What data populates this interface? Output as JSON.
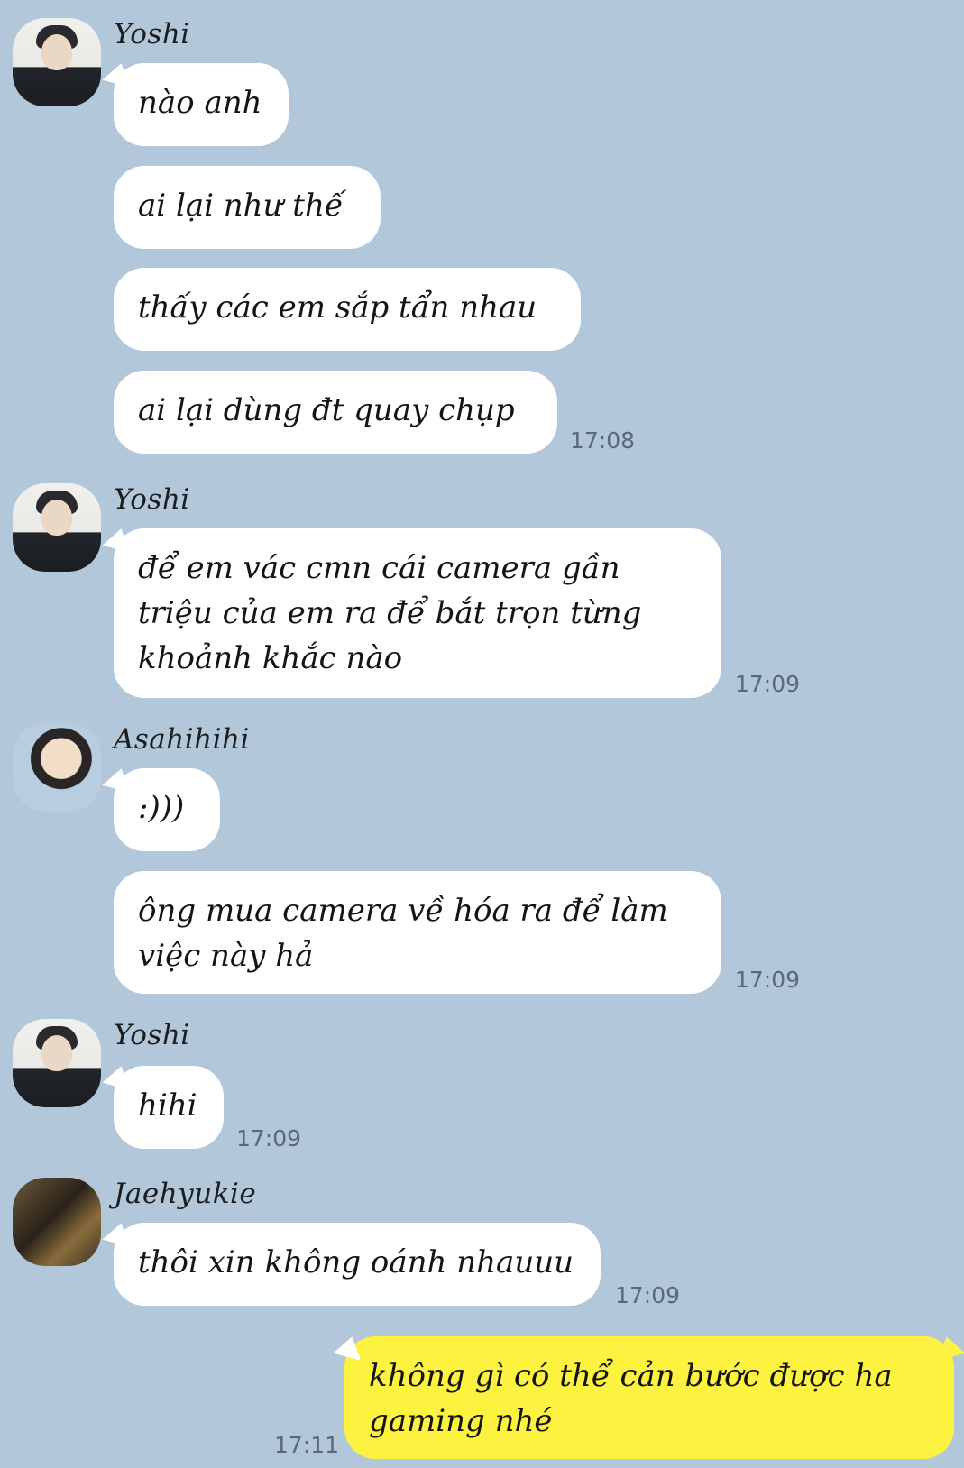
{
  "chat": {
    "groups": [
      {
        "sender": "Yoshi",
        "messages": [
          "nào anh",
          "ai lại như thế",
          "thấy các em sắp tẩn nhau",
          "ai lại dùng đt quay chụp"
        ],
        "time": "17:08"
      },
      {
        "sender": "Yoshi",
        "messages": [
          "để em vác cmn cái camera gần triệu của em ra để bắt trọn từng khoảnh khắc nào"
        ],
        "time": "17:09"
      },
      {
        "sender": "Asahihihi",
        "messages": [
          ":)))",
          "ông mua camera về hóa ra để làm việc này hả"
        ],
        "time": "17:09"
      },
      {
        "sender": "Yoshi",
        "messages": [
          "hihi"
        ],
        "time": "17:09"
      },
      {
        "sender": "Jaehyukie",
        "messages": [
          "thôi xin không oánh nhauuu"
        ],
        "time": "17:09"
      }
    ],
    "mine": {
      "message": "không gì có thể cản bước được ha gaming nhé",
      "time": "17:11"
    }
  },
  "colors": {
    "background": "#b3c7db",
    "incoming_bubble": "#ffffff",
    "outgoing_bubble": "#fef240",
    "time_text": "#5b6878"
  }
}
